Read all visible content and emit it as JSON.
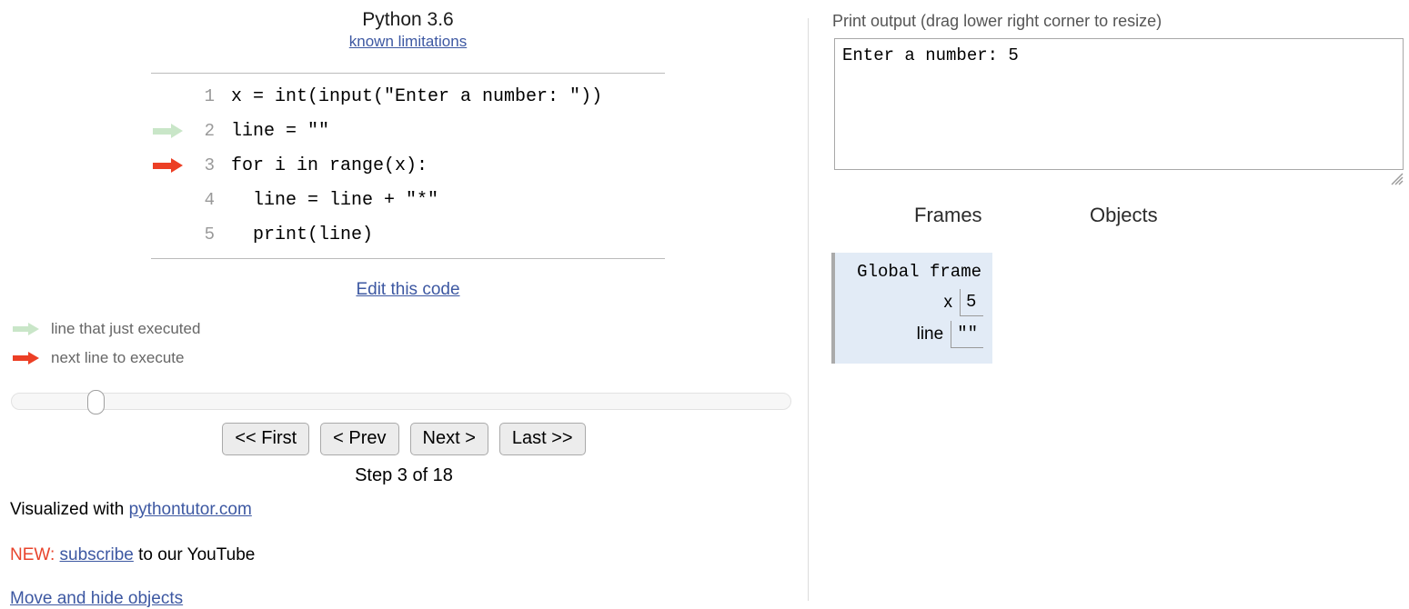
{
  "code_panel": {
    "python_version": "Python 3.6",
    "known_limitations_link": "known limitations",
    "edit_code_link": "Edit this code",
    "lines": [
      {
        "number": "1",
        "text": "x = int(input(\"Enter a number: \"))",
        "arrow": "none"
      },
      {
        "number": "2",
        "text": "line = \"\"",
        "arrow": "green"
      },
      {
        "number": "3",
        "text": "for i in range(x):",
        "arrow": "red"
      },
      {
        "number": "4",
        "text": "  line = line + \"*\"",
        "arrow": "none"
      },
      {
        "number": "5",
        "text": "  print(line)",
        "arrow": "none"
      }
    ]
  },
  "legend": {
    "executed": "line that just executed",
    "next": "next line to execute",
    "executed_icon": "green-arrow-icon",
    "next_icon": "red-arrow-icon"
  },
  "controls": {
    "first": "<< First",
    "prev": "< Prev",
    "next": "Next >",
    "last": "Last >>",
    "step_label": "Step 3 of 18",
    "slider_value_step": 3,
    "slider_max_step": 18
  },
  "footer": {
    "credit_prefix": "Visualized with ",
    "credit_link": "pythontutor.com",
    "new_badge": "NEW:",
    "subscribe_link": "subscribe",
    "subscribe_suffix": " to our YouTube",
    "move_hide_link": "Move and hide objects"
  },
  "output_panel": {
    "print_output_label": "Print output (drag lower right corner to resize)",
    "print_output_text": "Enter a number: 5",
    "resize_grip_icon": "resize-grip-icon"
  },
  "viz_panel": {
    "frames_header": "Frames",
    "objects_header": "Objects",
    "frames": [
      {
        "title": "Global frame",
        "variables": [
          {
            "name": "x",
            "value": "5"
          },
          {
            "name": "line",
            "value": "\"\""
          }
        ]
      }
    ]
  },
  "colors": {
    "green_arrow": "#c9e6c8",
    "red_arrow": "#ec3f25",
    "link": "#3d58a2",
    "frame_bg": "#e2ebf6",
    "new_badge": "#e8442c"
  }
}
